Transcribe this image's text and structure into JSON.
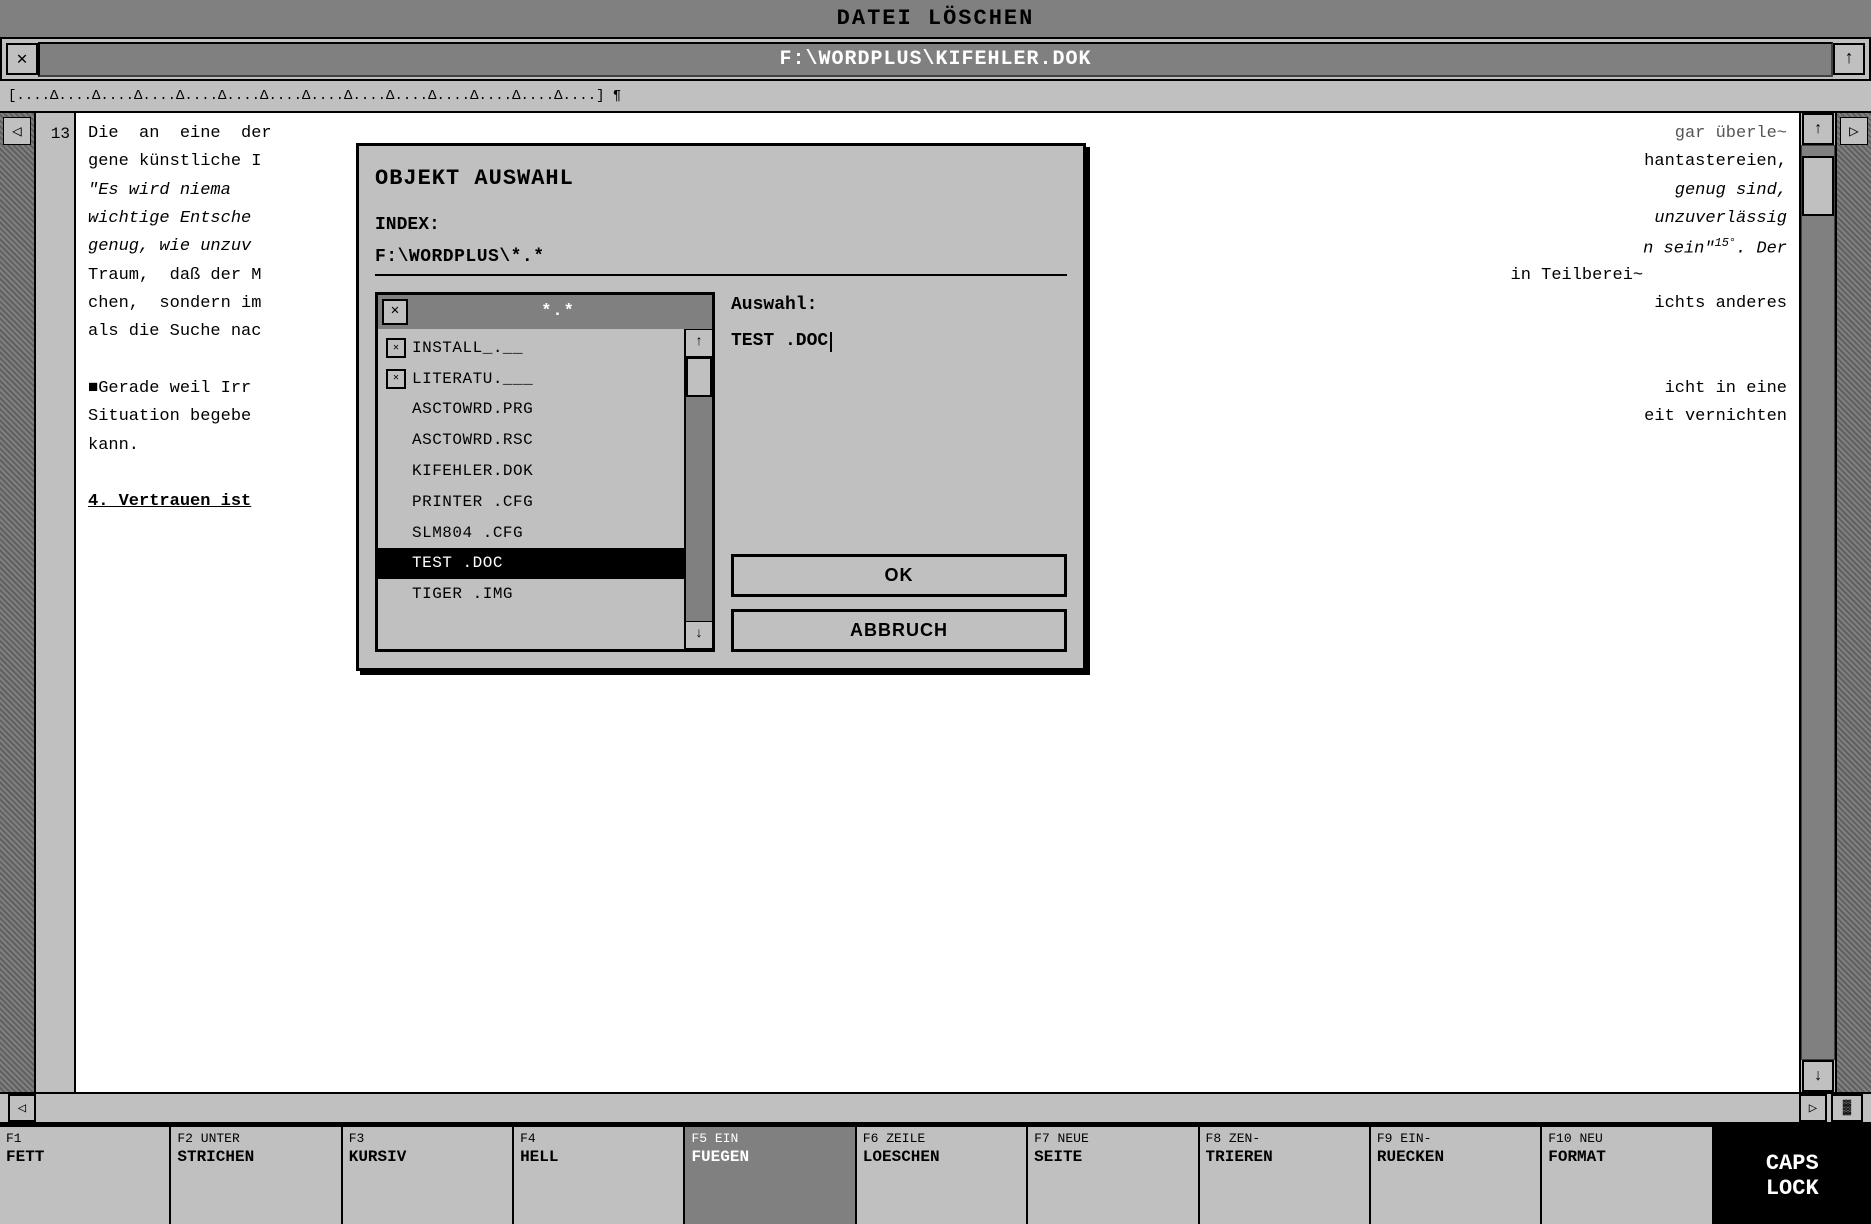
{
  "window": {
    "title": "DATEI LÖSCHEN",
    "menu_path": "F:\\WORDPLUS\\KIFEHLER.DOK",
    "close_icon": "✕",
    "scroll_up_icon": "↑",
    "scroll_down_icon": "↓",
    "scroll_left_icon": "◁",
    "scroll_right_icon": "▷"
  },
  "ruler": {
    "text": "[....Δ....Δ....Δ....Δ....Δ....Δ....Δ....Δ....Δ....Δ....Δ....Δ....Δ....] ¶"
  },
  "document": {
    "line_number": "13",
    "paragraphs": [
      "Die  an  eine  der",
      "gene künstliche I",
      "\"Es wird niema",
      "wichtige Entsche",
      "genug, wie unzuv",
      "Traum,  daß der M",
      "chen,  sondern im",
      "als die Suche nac",
      "",
      "Gerade weil Irr",
      "Situation begebe",
      "kann."
    ],
    "right_fragments": [
      "gar überle~",
      "hantastereien,",
      "genug sind,",
      "unzuverlässig",
      "n sein\"^15°. Der",
      "in Teilberei~",
      "ichts anderes",
      "",
      "",
      "icht in eine",
      "eit vernichten"
    ],
    "section_heading": "4. Vertrauen ist"
  },
  "dialog": {
    "title": "OBJEKT AUSWAHL",
    "index_label": "INDEX:",
    "index_value": "F:\\WORDPLUS\\*.*",
    "file_list": {
      "title": "*.*",
      "files": [
        {
          "name": "INSTALL_.__",
          "has_icon": true,
          "selected": false
        },
        {
          "name": "LITERATU.___",
          "has_icon": true,
          "selected": false
        },
        {
          "name": "ASCTOWRD.PRG",
          "has_icon": false,
          "selected": false
        },
        {
          "name": "ASCTOWRD.RSC",
          "has_icon": false,
          "selected": false
        },
        {
          "name": "KIFEHLER.DOK",
          "has_icon": false,
          "selected": false
        },
        {
          "name": "PRINTER  .CFG",
          "has_icon": false,
          "selected": false
        },
        {
          "name": "SLM804   .CFG",
          "has_icon": false,
          "selected": false
        },
        {
          "name": "TEST     .DOC",
          "has_icon": false,
          "selected": true
        },
        {
          "name": "TIGER    .IMG",
          "has_icon": false,
          "selected": false
        }
      ]
    },
    "auswahl_label": "Auswahl:",
    "auswahl_value": "TEST     .DOC",
    "ok_button": "OK",
    "cancel_button": "ABBRUCH"
  },
  "function_keys": [
    {
      "num": "F1",
      "label": "FETT"
    },
    {
      "num": "F2 UNTER",
      "label": "STRICHEN"
    },
    {
      "num": "F3",
      "label": "KURSIV"
    },
    {
      "num": "F4",
      "label": "HELL"
    },
    {
      "num": "F5 EIN",
      "label": "FUEGEN"
    },
    {
      "num": "F6 ZEILE",
      "label": "LOESCHEN"
    },
    {
      "num": "F7 NEUE",
      "label": "SEITE"
    },
    {
      "num": "F8 ZEN-",
      "label": "TRIEREN"
    },
    {
      "num": "F9 EIN-",
      "label": "RUECKEN"
    },
    {
      "num": "F10 NEU",
      "label": "FORMAT"
    },
    {
      "num": "CAPS",
      "label": "LOCK"
    }
  ]
}
